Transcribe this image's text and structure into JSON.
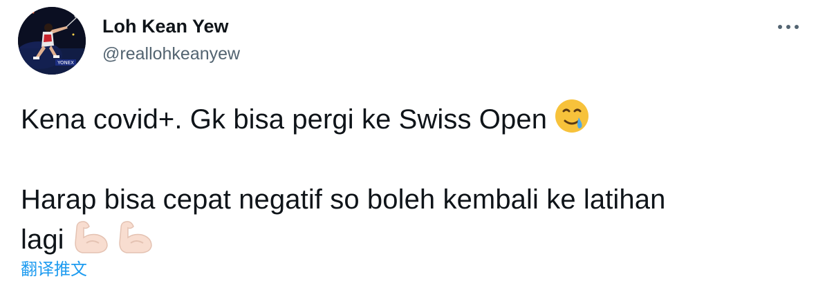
{
  "author": {
    "display_name": "Loh Kean Yew",
    "handle": "@reallohkeanyew",
    "avatar_icon": "badminton-player-avatar",
    "avatar_banner_text": "YONEX"
  },
  "menu": {
    "more_icon": "ellipsis-icon"
  },
  "tweet": {
    "line1": "Kena covid+. Gk bisa pergi ke Swiss Open",
    "line1_emoji": "face-holding-back-tears",
    "line2a": "Harap bisa cepat negatif so boleh kembali ke latihan",
    "line2b": "lagi",
    "line2_emojis": [
      "flexed-biceps-light-skin",
      "flexed-biceps-light-skin"
    ]
  },
  "translate": {
    "label": "翻译推文"
  },
  "colors": {
    "text": "#0f1419",
    "secondary": "#536471",
    "link": "#1d9bf0"
  }
}
